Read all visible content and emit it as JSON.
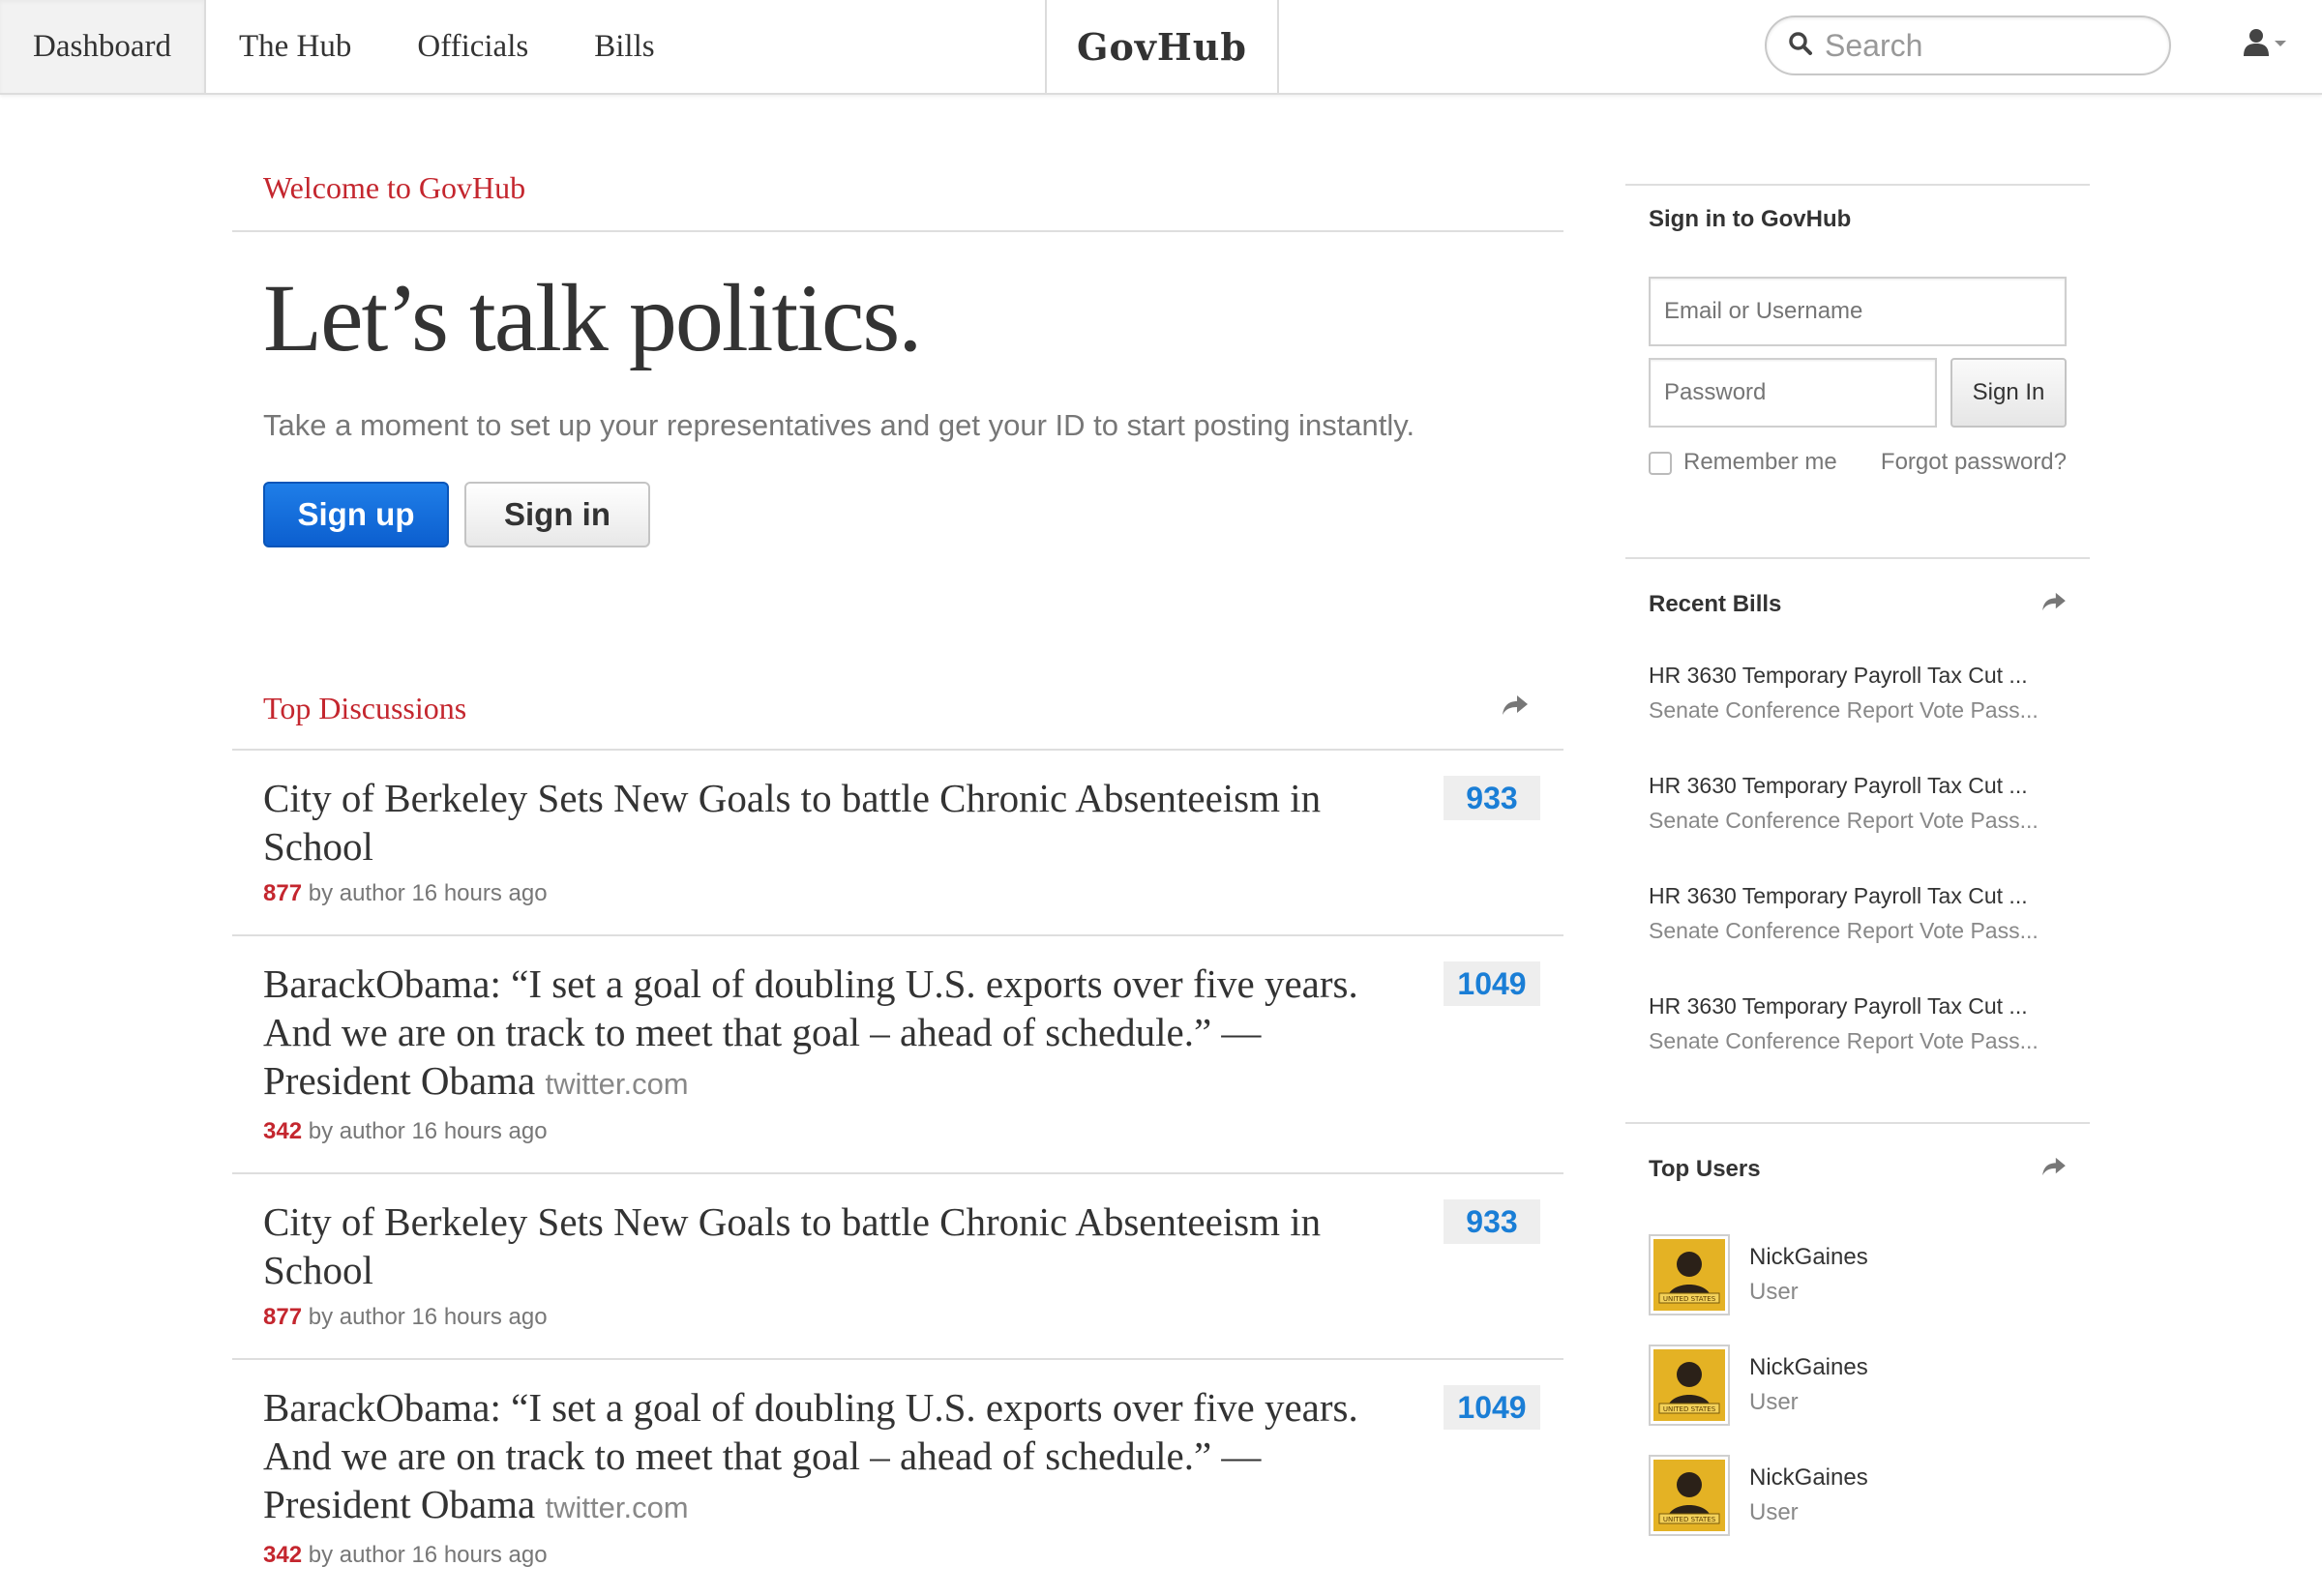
{
  "nav": {
    "tabs": [
      {
        "label": "Dashboard"
      },
      {
        "label": "The Hub"
      },
      {
        "label": "Officials"
      },
      {
        "label": "Bills"
      }
    ],
    "brand": "GovHub",
    "search_placeholder": "Search"
  },
  "hero": {
    "label": "Welcome to GovHub",
    "title": "Let’s talk politics.",
    "subtitle": "Take a moment to set up your representatives and get your ID to start posting instantly.",
    "signup_label": "Sign up",
    "signin_label": "Sign in"
  },
  "discussions": {
    "label": "Top Discussions",
    "items": [
      {
        "title": "City of Berkeley Sets New Goals to battle Chronic Absenteeism in School",
        "source": "",
        "score": "877",
        "meta": " by author 16 hours ago",
        "count": "933"
      },
      {
        "title": "BarackObama: “I set a goal of doubling U.S. exports over five years. And we are on track to meet that goal – ahead of schedule.” — President Obama",
        "source": "twitter.com",
        "score": "342",
        "meta": " by author 16 hours ago",
        "count": "1049"
      },
      {
        "title": "City of Berkeley Sets New Goals to battle Chronic Absenteeism in School",
        "source": "",
        "score": "877",
        "meta": " by author 16 hours ago",
        "count": "933"
      },
      {
        "title": "BarackObama: “I set a goal of doubling U.S. exports over five years. And we are on track to meet that goal – ahead of schedule.” — President Obama",
        "source": "twitter.com",
        "score": "342",
        "meta": " by author 16 hours ago",
        "count": "1049"
      }
    ]
  },
  "signin": {
    "heading": "Sign in to GovHub",
    "email_placeholder": "Email or Username",
    "password_placeholder": "Password",
    "button_label": "Sign In",
    "remember_label": "Remember me",
    "forgot_label": "Forgot password?"
  },
  "recent_bills": {
    "heading": "Recent Bills",
    "items": [
      {
        "title": "HR 3630 Temporary Payroll Tax Cut ...",
        "subtitle": "Senate Conference Report Vote Pass..."
      },
      {
        "title": "HR 3630 Temporary Payroll Tax Cut ...",
        "subtitle": "Senate Conference Report Vote Pass..."
      },
      {
        "title": "HR 3630 Temporary Payroll Tax Cut ...",
        "subtitle": "Senate Conference Report Vote Pass..."
      },
      {
        "title": "HR 3630 Temporary Payroll Tax Cut ...",
        "subtitle": "Senate Conference Report Vote Pass..."
      }
    ]
  },
  "top_users": {
    "heading": "Top Users",
    "avatar_text": "UNITED STATES",
    "items": [
      {
        "name": "NickGaines",
        "role": "User"
      },
      {
        "name": "NickGaines",
        "role": "User"
      },
      {
        "name": "NickGaines",
        "role": "User"
      }
    ]
  },
  "colors": {
    "accent_red": "#c4262e",
    "link_blue": "#1a7ed6",
    "primary_button": "#0c5fcf"
  },
  "icons": [
    "search-icon",
    "user-icon",
    "caret-down-icon",
    "share-arrow-icon",
    "checkbox-icon"
  ]
}
